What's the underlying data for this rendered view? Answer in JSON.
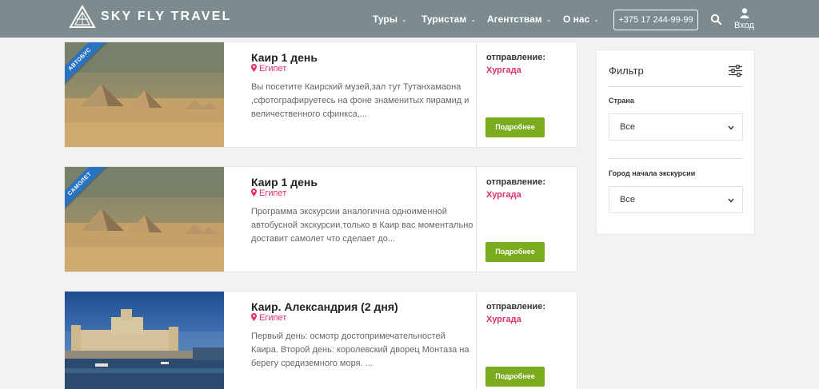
{
  "header": {
    "logo_text": "SKY FLY TRAVEL",
    "nav": [
      {
        "label": "Туры"
      },
      {
        "label": "Туристам"
      },
      {
        "label": "Агентствам"
      },
      {
        "label": "О нас"
      }
    ],
    "phone": "+375 17 244-99-99",
    "login_label": "Вход"
  },
  "tours": [
    {
      "ribbon": "АВТОБУС",
      "title": "Каир 1 день",
      "country": "Египет",
      "description": "Вы посетите Каирский музей,зал тут Тутанхамаона ,сфотографируетесь на фоне знаменитых  пирамид и величественного сфинкса,...",
      "departure_label": "отправление:",
      "departure_city": "Хургада",
      "button_label": "Подробнее"
    },
    {
      "ribbon": "САМОЛЕТ",
      "title": "Каир 1 день",
      "country": "Египет",
      "description": "Программа экскурсии аналогична одноименной автобусной экскурсии,только в Каир вас моментально доставит самолет что сделает до...",
      "departure_label": "отправление:",
      "departure_city": "Хургада",
      "button_label": "Подробнее"
    },
    {
      "ribbon": "",
      "title": "Каир. Александрия (2 дня)",
      "country": "Египет",
      "description": "Первый день: осмотр достопримечательностей Каира. Второй день: королевский дворец Монтаза на берегу средиземного моря. ...",
      "departure_label": "отправление:",
      "departure_city": "Хургада",
      "button_label": "Подробнее"
    }
  ],
  "filter": {
    "title": "Фильтр",
    "country_label": "Страна",
    "country_value": "Все",
    "city_label": "Город начала экскурсии",
    "city_value": "Все"
  },
  "colors": {
    "header_bg": "#7d8b8f",
    "accent_pink": "#e0306f",
    "button_green": "#7bab1e",
    "ribbon_blue": "#2a73c2"
  },
  "icons": [
    "logo-triangle-icon",
    "chevron-down-icon",
    "search-icon",
    "user-icon",
    "map-pin-icon",
    "sliders-icon"
  ]
}
